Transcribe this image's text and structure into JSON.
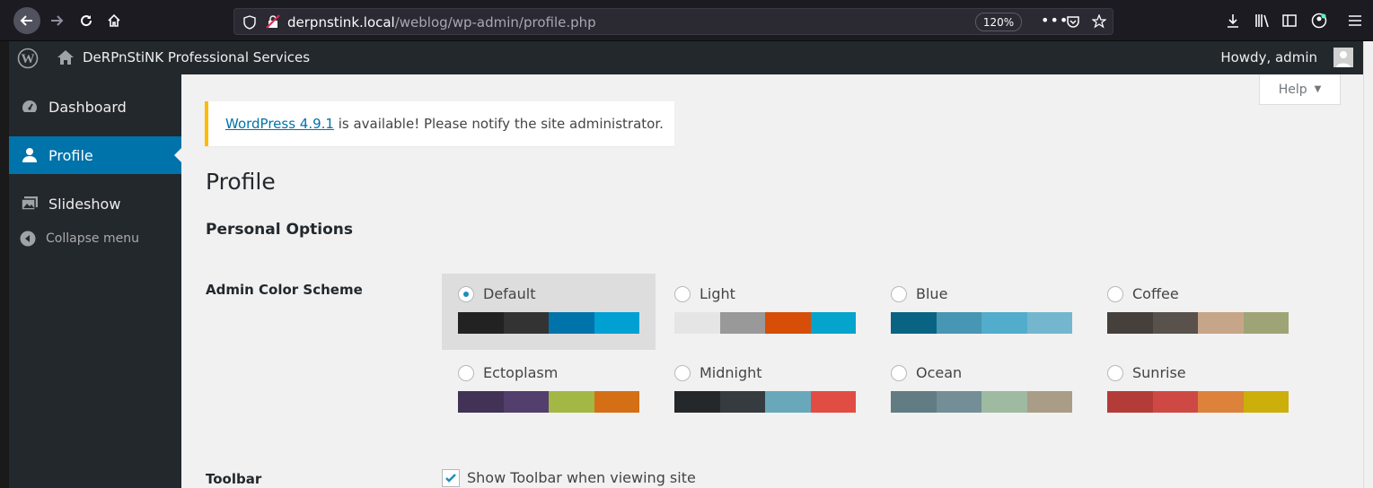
{
  "browser": {
    "url_host": "derpnstink.local",
    "url_path": "/weblog/wp-admin/profile.php",
    "zoom": "120%"
  },
  "adminbar": {
    "site_name": "DeRPnStiNK Professional Services",
    "howdy": "Howdy, admin"
  },
  "sidebar": {
    "items": [
      {
        "label": "Dashboard",
        "icon": "dashboard-icon"
      },
      {
        "label": "Profile",
        "icon": "user-icon"
      },
      {
        "label": "Slideshow",
        "icon": "slideshow-icon"
      }
    ],
    "collapse_label": "Collapse menu"
  },
  "help": {
    "label": "Help"
  },
  "notice": {
    "link_text": "WordPress 4.9.1",
    "text": " is available! Please notify the site administrator."
  },
  "page": {
    "title": "Profile",
    "section": "Personal Options",
    "color_scheme_label": "Admin Color Scheme",
    "toolbar_label": "Toolbar",
    "toolbar_checkbox_label": "Show Toolbar when viewing site"
  },
  "schemes": [
    {
      "name": "Default",
      "selected": true,
      "colors": [
        "#222222",
        "#333333",
        "#0073aa",
        "#00a0d2"
      ]
    },
    {
      "name": "Light",
      "selected": false,
      "colors": [
        "#e5e5e5",
        "#999999",
        "#d64e07",
        "#04a4cc"
      ]
    },
    {
      "name": "Blue",
      "selected": false,
      "colors": [
        "#096484",
        "#4796b3",
        "#52accc",
        "#74b6ce"
      ]
    },
    {
      "name": "Coffee",
      "selected": false,
      "colors": [
        "#46403c",
        "#59524c",
        "#c7a589",
        "#9ea476"
      ]
    },
    {
      "name": "Ectoplasm",
      "selected": false,
      "colors": [
        "#413256",
        "#523f6d",
        "#a3b745",
        "#d46f15"
      ]
    },
    {
      "name": "Midnight",
      "selected": false,
      "colors": [
        "#25282b",
        "#363b3f",
        "#69a8bb",
        "#e14d43"
      ]
    },
    {
      "name": "Ocean",
      "selected": false,
      "colors": [
        "#627c83",
        "#738e96",
        "#9ebaa0",
        "#aa9d88"
      ]
    },
    {
      "name": "Sunrise",
      "selected": false,
      "colors": [
        "#b43c38",
        "#cf4944",
        "#dd823b",
        "#ccaf0b"
      ]
    }
  ]
}
